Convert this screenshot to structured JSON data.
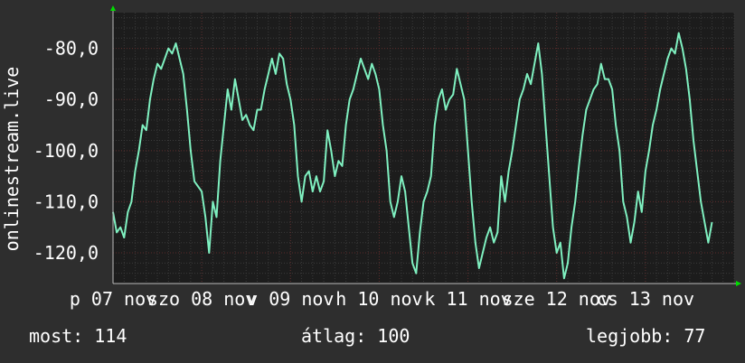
{
  "chart_data": {
    "type": "line",
    "ylabel": "onlinestream.live",
    "xlim": [
      0,
      168
    ],
    "ylim": [
      -126,
      -73
    ],
    "yticks": [
      {
        "value": -80,
        "label": "-80,0"
      },
      {
        "value": -90,
        "label": "-90,0"
      },
      {
        "value": -100,
        "label": "-100,0"
      },
      {
        "value": -110,
        "label": "-110,0"
      },
      {
        "value": -120,
        "label": "-120,0"
      }
    ],
    "xticks": [
      {
        "value": 0,
        "label": "p 07 nov"
      },
      {
        "value": 24,
        "label": "szo 08 nov"
      },
      {
        "value": 48,
        "label": "v 09 nov"
      },
      {
        "value": 72,
        "label": "h 10 nov"
      },
      {
        "value": 96,
        "label": "k 11 nov"
      },
      {
        "value": 120,
        "label": "sze 12 nov"
      },
      {
        "value": 144,
        "label": "cs 13 nov"
      }
    ],
    "grid": true,
    "colors": {
      "background": "#2e2e2e",
      "plot_area": "#1c1c1c",
      "grid_minor": "#3a3a3a",
      "grid_major": "#5a2a2a",
      "line": "#7ff0c0",
      "axis_arrow": "#00dd00"
    },
    "series": [
      {
        "values": [
          [
            0,
            -112
          ],
          [
            1,
            -116
          ],
          [
            2,
            -115
          ],
          [
            3,
            -117
          ],
          [
            4,
            -112
          ],
          [
            5,
            -110
          ],
          [
            6,
            -104
          ],
          [
            7,
            -100
          ],
          [
            8,
            -95
          ],
          [
            9,
            -96
          ],
          [
            10,
            -90
          ],
          [
            11,
            -86
          ],
          [
            12,
            -83
          ],
          [
            13,
            -84
          ],
          [
            14,
            -82
          ],
          [
            15,
            -80
          ],
          [
            16,
            -81
          ],
          [
            17,
            -79
          ],
          [
            18,
            -82
          ],
          [
            19,
            -85
          ],
          [
            20,
            -92
          ],
          [
            21,
            -100
          ],
          [
            22,
            -106
          ],
          [
            23,
            -107
          ],
          [
            24,
            -108
          ],
          [
            25,
            -113
          ],
          [
            26,
            -120
          ],
          [
            27,
            -110
          ],
          [
            28,
            -113
          ],
          [
            29,
            -102
          ],
          [
            30,
            -95
          ],
          [
            31,
            -88
          ],
          [
            32,
            -92
          ],
          [
            33,
            -86
          ],
          [
            34,
            -90
          ],
          [
            35,
            -94
          ],
          [
            36,
            -93
          ],
          [
            37,
            -95
          ],
          [
            38,
            -96
          ],
          [
            39,
            -92
          ],
          [
            40,
            -92
          ],
          [
            41,
            -88
          ],
          [
            42,
            -85
          ],
          [
            43,
            -82
          ],
          [
            44,
            -85
          ],
          [
            45,
            -81
          ],
          [
            46,
            -82
          ],
          [
            47,
            -87
          ],
          [
            48,
            -90
          ],
          [
            49,
            -95
          ],
          [
            50,
            -105
          ],
          [
            51,
            -110
          ],
          [
            52,
            -105
          ],
          [
            53,
            -104
          ],
          [
            54,
            -108
          ],
          [
            55,
            -105
          ],
          [
            56,
            -108
          ],
          [
            57,
            -106
          ],
          [
            58,
            -96
          ],
          [
            59,
            -100
          ],
          [
            60,
            -105
          ],
          [
            61,
            -102
          ],
          [
            62,
            -103
          ],
          [
            63,
            -95
          ],
          [
            64,
            -90
          ],
          [
            65,
            -88
          ],
          [
            66,
            -85
          ],
          [
            67,
            -82
          ],
          [
            68,
            -84
          ],
          [
            69,
            -86
          ],
          [
            70,
            -83
          ],
          [
            71,
            -85
          ],
          [
            72,
            -88
          ],
          [
            73,
            -95
          ],
          [
            74,
            -100
          ],
          [
            75,
            -110
          ],
          [
            76,
            -113
          ],
          [
            77,
            -110
          ],
          [
            78,
            -105
          ],
          [
            79,
            -108
          ],
          [
            80,
            -115
          ],
          [
            81,
            -122
          ],
          [
            82,
            -124
          ],
          [
            83,
            -116
          ],
          [
            84,
            -110
          ],
          [
            85,
            -108
          ],
          [
            86,
            -105
          ],
          [
            87,
            -95
          ],
          [
            88,
            -90
          ],
          [
            89,
            -88
          ],
          [
            90,
            -92
          ],
          [
            91,
            -90
          ],
          [
            92,
            -89
          ],
          [
            93,
            -84
          ],
          [
            94,
            -87
          ],
          [
            95,
            -90
          ],
          [
            96,
            -100
          ],
          [
            97,
            -110
          ],
          [
            98,
            -118
          ],
          [
            99,
            -123
          ],
          [
            100,
            -120
          ],
          [
            101,
            -117
          ],
          [
            102,
            -115
          ],
          [
            103,
            -118
          ],
          [
            104,
            -116
          ],
          [
            105,
            -105
          ],
          [
            106,
            -110
          ],
          [
            107,
            -104
          ],
          [
            108,
            -100
          ],
          [
            109,
            -95
          ],
          [
            110,
            -90
          ],
          [
            111,
            -88
          ],
          [
            112,
            -85
          ],
          [
            113,
            -87
          ],
          [
            114,
            -83
          ],
          [
            115,
            -79
          ],
          [
            116,
            -85
          ],
          [
            117,
            -95
          ],
          [
            118,
            -105
          ],
          [
            119,
            -115
          ],
          [
            120,
            -120
          ],
          [
            121,
            -118
          ],
          [
            122,
            -125
          ],
          [
            123,
            -122
          ],
          [
            124,
            -115
          ],
          [
            125,
            -110
          ],
          [
            126,
            -103
          ],
          [
            127,
            -97
          ],
          [
            128,
            -92
          ],
          [
            129,
            -90
          ],
          [
            130,
            -88
          ],
          [
            131,
            -87
          ],
          [
            132,
            -83
          ],
          [
            133,
            -86
          ],
          [
            134,
            -86
          ],
          [
            135,
            -88
          ],
          [
            136,
            -95
          ],
          [
            137,
            -100
          ],
          [
            138,
            -110
          ],
          [
            139,
            -113
          ],
          [
            140,
            -118
          ],
          [
            141,
            -114
          ],
          [
            142,
            -108
          ],
          [
            143,
            -112
          ],
          [
            144,
            -104
          ],
          [
            145,
            -100
          ],
          [
            146,
            -95
          ],
          [
            147,
            -92
          ],
          [
            148,
            -88
          ],
          [
            149,
            -85
          ],
          [
            150,
            -82
          ],
          [
            151,
            -80
          ],
          [
            152,
            -81
          ],
          [
            153,
            -77
          ],
          [
            154,
            -80
          ],
          [
            155,
            -84
          ],
          [
            156,
            -90
          ],
          [
            157,
            -98
          ],
          [
            158,
            -104
          ],
          [
            159,
            -110
          ],
          [
            160,
            -114
          ],
          [
            161,
            -118
          ],
          [
            162,
            -114
          ]
        ]
      }
    ]
  },
  "stats": {
    "current_label": "most: 114",
    "average_label": "átlag: 100",
    "best_label": "legjobb: 77"
  }
}
